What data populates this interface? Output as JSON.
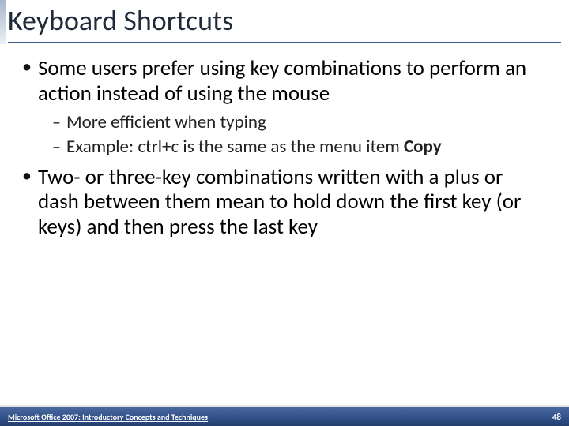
{
  "title": "Keyboard Shortcuts",
  "bullets": {
    "b1": "Some users prefer using key combinations to perform an action instead of using the mouse",
    "b1_sub1": "More efficient when typing",
    "b1_sub2_pre": "Example:  ctrl+c is the same as the menu item ",
    "b1_sub2_bold": "Copy",
    "b2": "Two- or three-key combinations written with a plus or dash between them mean to hold down the first key (or keys) and then press the last key"
  },
  "footer": {
    "left": "Microsoft Office 2007: Introductory Concepts and Techniques",
    "page": "48"
  }
}
